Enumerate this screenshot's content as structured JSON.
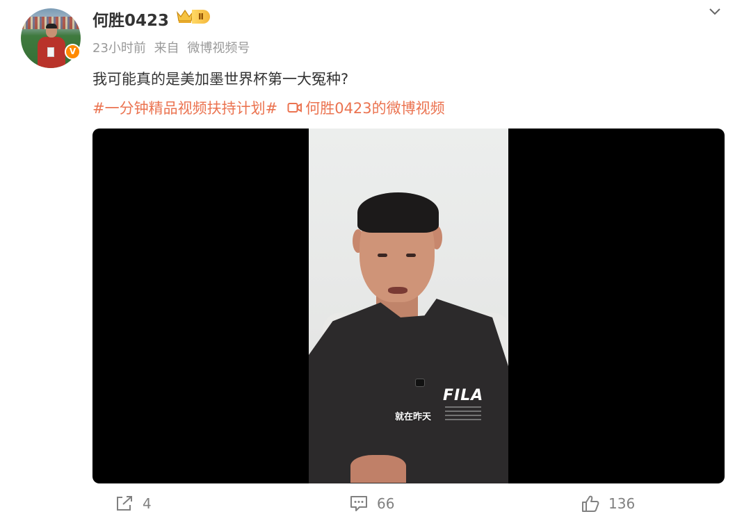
{
  "post": {
    "author": {
      "name": "何胜0423",
      "level_badge": "II",
      "verified_badge": "V"
    },
    "meta": {
      "time": "23小时前",
      "source_prefix": "来自",
      "source": "微博视频号"
    },
    "text": "我可能真的是美加墨世界杯第一大冤种?",
    "topic_tag": "#一分钟精品视频扶持计划#",
    "video_link_label": "何胜0423的微博视频",
    "video": {
      "shirt_logo": "FILA",
      "subtitle": "就在昨天"
    }
  },
  "actions": {
    "share_count": "4",
    "comment_count": "66",
    "like_count": "136"
  },
  "colors": {
    "accent": "#eb7350",
    "meta": "#999999",
    "action": "#808080",
    "verified": "#ff8a00"
  }
}
